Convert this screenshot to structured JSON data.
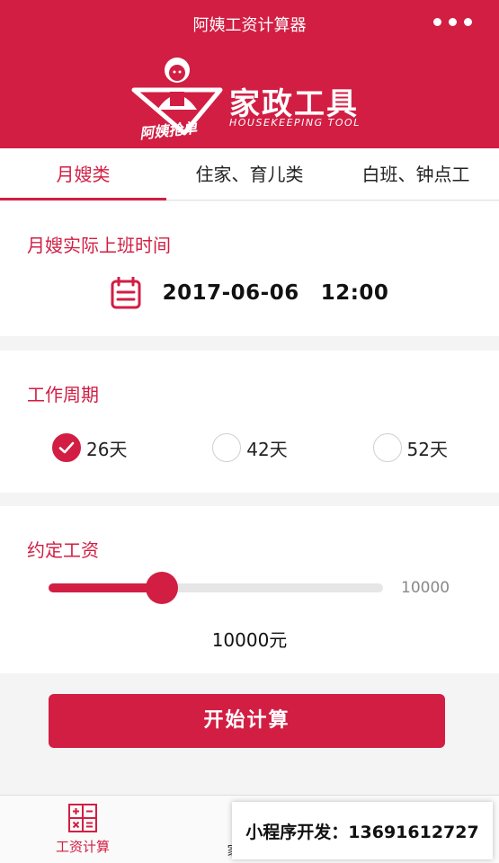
{
  "nav": {
    "title": "阿姨工资计算器"
  },
  "logo": {
    "main": "家政工具",
    "sub": "HOUSEKEEPING TOOL",
    "badge": "阿姨抢单"
  },
  "tabs": [
    "月嫂类",
    "住家、育儿类",
    "白班、钟点工"
  ],
  "start_time": {
    "title": "月嫂实际上班时间",
    "date": "2017-06-06",
    "time": "12:00"
  },
  "period": {
    "title": "工作周期",
    "options": [
      {
        "label": "26天",
        "checked": true
      },
      {
        "label": "42天",
        "checked": false
      },
      {
        "label": "52天",
        "checked": false
      }
    ]
  },
  "salary": {
    "title": "约定工资",
    "slider_level": 0.34,
    "max_label": "10000",
    "value": "10000元"
  },
  "start_button": "开始计算",
  "tabbar": {
    "items": [
      {
        "label": "工资计算",
        "active": true
      },
      {
        "label": "家",
        "active": false
      }
    ]
  },
  "contact": "小程序开发：13691612727",
  "colors": {
    "accent": "#d21e43"
  }
}
